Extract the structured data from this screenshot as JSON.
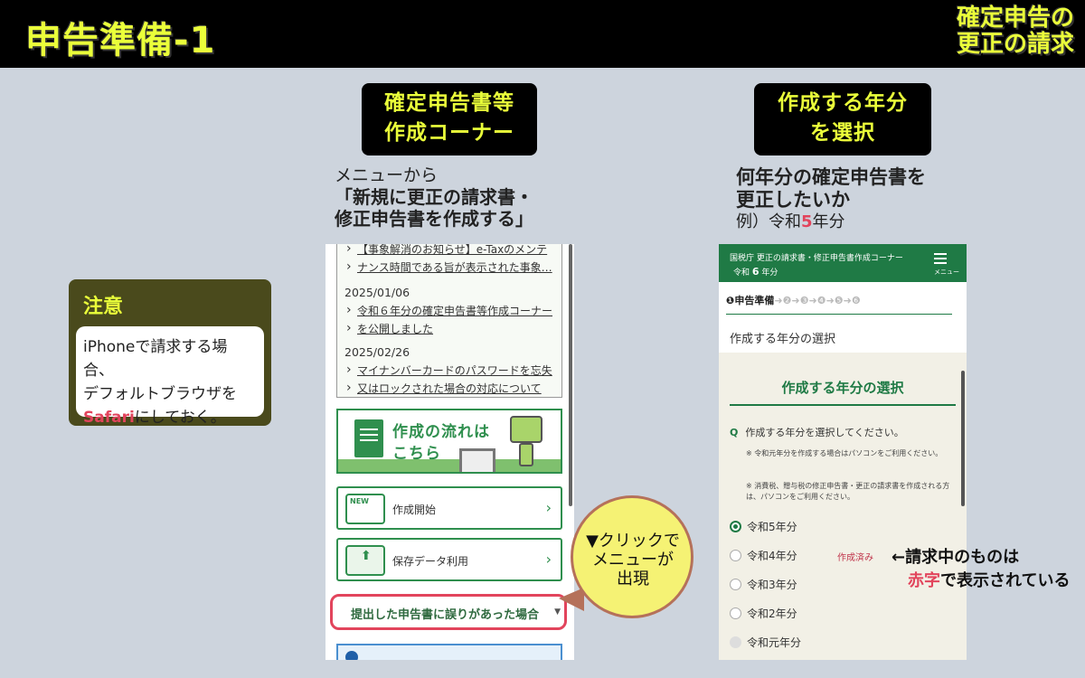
{
  "header": {
    "title": "申告準備-1",
    "topic_line1": "確定申告の",
    "topic_line2": "更正の請求"
  },
  "section1": {
    "badge_line1": "確定申告書等",
    "badge_line2": "作成コーナー",
    "desc_sub": "メニューから",
    "desc_main1": "「新規に更正の請求書・",
    "desc_main2": "修正申告書を作成する」"
  },
  "section2": {
    "badge_line1": "作成する年分",
    "badge_line2": "を選択",
    "desc_main1": "何年分の確定申告書を",
    "desc_main2": "更正したいか",
    "desc_ex_prefix": "例）令和",
    "desc_ex_num": "5",
    "desc_ex_suffix": "年分"
  },
  "note": {
    "title": "注意",
    "line1": "iPhoneで請求する場合、",
    "line2": "デフォルトブラウザを",
    "safari": "Safari",
    "line3_suffix": "にしておく。"
  },
  "phone1": {
    "news": [
      {
        "link1": "【事象解消のお知らせ】e-Taxのメンテ",
        "link2": "ナンス時間である旨が表示された事象…"
      },
      {
        "date": "2025/01/06",
        "link1": "令和６年分の確定申告書等作成コーナー",
        "link2": "を公開しました"
      },
      {
        "date": "2025/02/26",
        "link1": "マイナンバーカードのパスワードを忘失",
        "link2": "又はロックされた場合の対応について"
      }
    ],
    "banner_line1": "作成の流れは",
    "banner_line2": "こちら",
    "btn_new_label": "作成開始",
    "btn_new_icon_text": "NEW",
    "btn_save_label": "保存データ利用",
    "dropdown_label": "提出した申告書に誤りがあった場合"
  },
  "callout": {
    "line1": "▼クリックで",
    "line2": "メニューが",
    "line3": "出現"
  },
  "phone2": {
    "header_line1": "国税庁 更正の請求書・修正申告書作成コーナー",
    "header_era": "令和",
    "header_year": "6",
    "header_suffix": "年分",
    "menu_label": "メニュー",
    "step_current": "❶申告準備",
    "step_rest": "➜❷➜❸➜❹➜❺➜❻",
    "subtitle": "作成する年分の選択",
    "heading": "作成する年分の選択",
    "q_mark": "Q",
    "question": "作成する年分を選択してください。",
    "note1": "※ 令和元年分を作成する場合はパソコンをご利用ください。",
    "note2": "※ 消費税、贈与税の修正申告書・更正の請求書を作成される方は、パソコンをご利用ください。",
    "options": [
      "令和5年分",
      "令和4年分",
      "令和3年分",
      "令和2年分",
      "令和元年分"
    ],
    "selected": "令和5年分",
    "done_label": "作成済み"
  },
  "annotation": {
    "line1": "←請求中のものは",
    "red": "赤字",
    "line2_suffix": "で表示されている"
  },
  "colors": {
    "accent_yellow": "#eaff3a",
    "brand_green": "#1f7a45",
    "alert_red": "#e2445c"
  }
}
